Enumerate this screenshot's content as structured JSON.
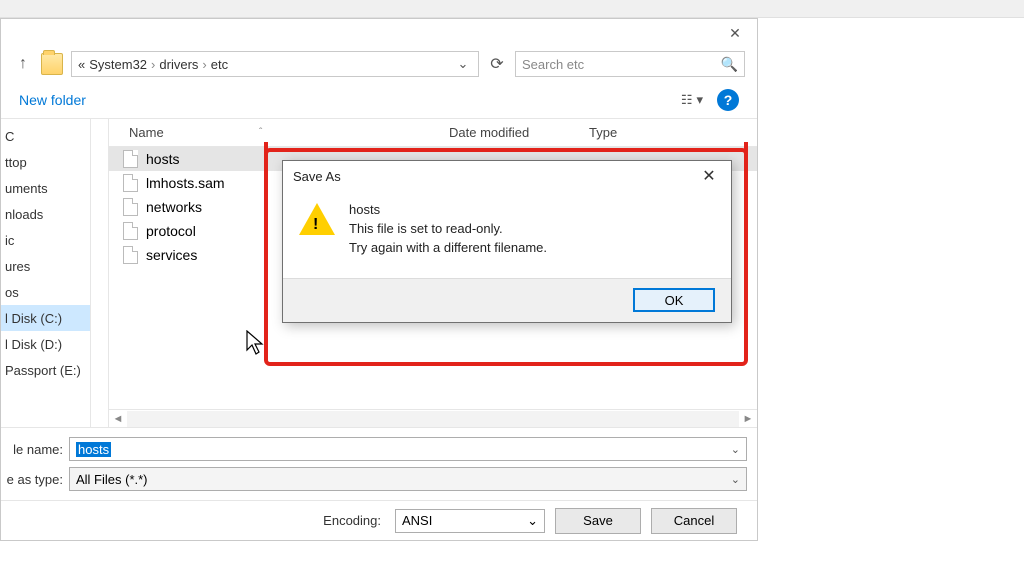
{
  "breadcrumb": {
    "prefix": "«",
    "p1": "System32",
    "p2": "drivers",
    "p3": "etc"
  },
  "search": {
    "placeholder": "Search etc"
  },
  "toolbar": {
    "new_folder": "New folder"
  },
  "columns": {
    "name": "Name",
    "date": "Date modified",
    "type": "Type"
  },
  "nav_items": [
    "C",
    "ttop",
    "uments",
    "nloads",
    "ic",
    "ures",
    "os",
    "l Disk (C:)",
    "l Disk (D:)",
    "Passport (E:)"
  ],
  "nav_selected_index": 7,
  "files": [
    "hosts",
    "lmhosts.sam",
    "networks",
    "protocol",
    "services"
  ],
  "file_selected_index": 0,
  "filename_label": "le name:",
  "filename_value": "hosts",
  "filetype_label": "e as type:",
  "filetype_value": "All Files  (*.*)",
  "encoding_label": "Encoding:",
  "encoding_value": "ANSI",
  "save_label": "Save",
  "cancel_label": "Cancel",
  "dialog": {
    "title": "Save As",
    "line1": "hosts",
    "line2": "This file is set to read-only.",
    "line3": "Try again with a different filename.",
    "ok": "OK"
  }
}
